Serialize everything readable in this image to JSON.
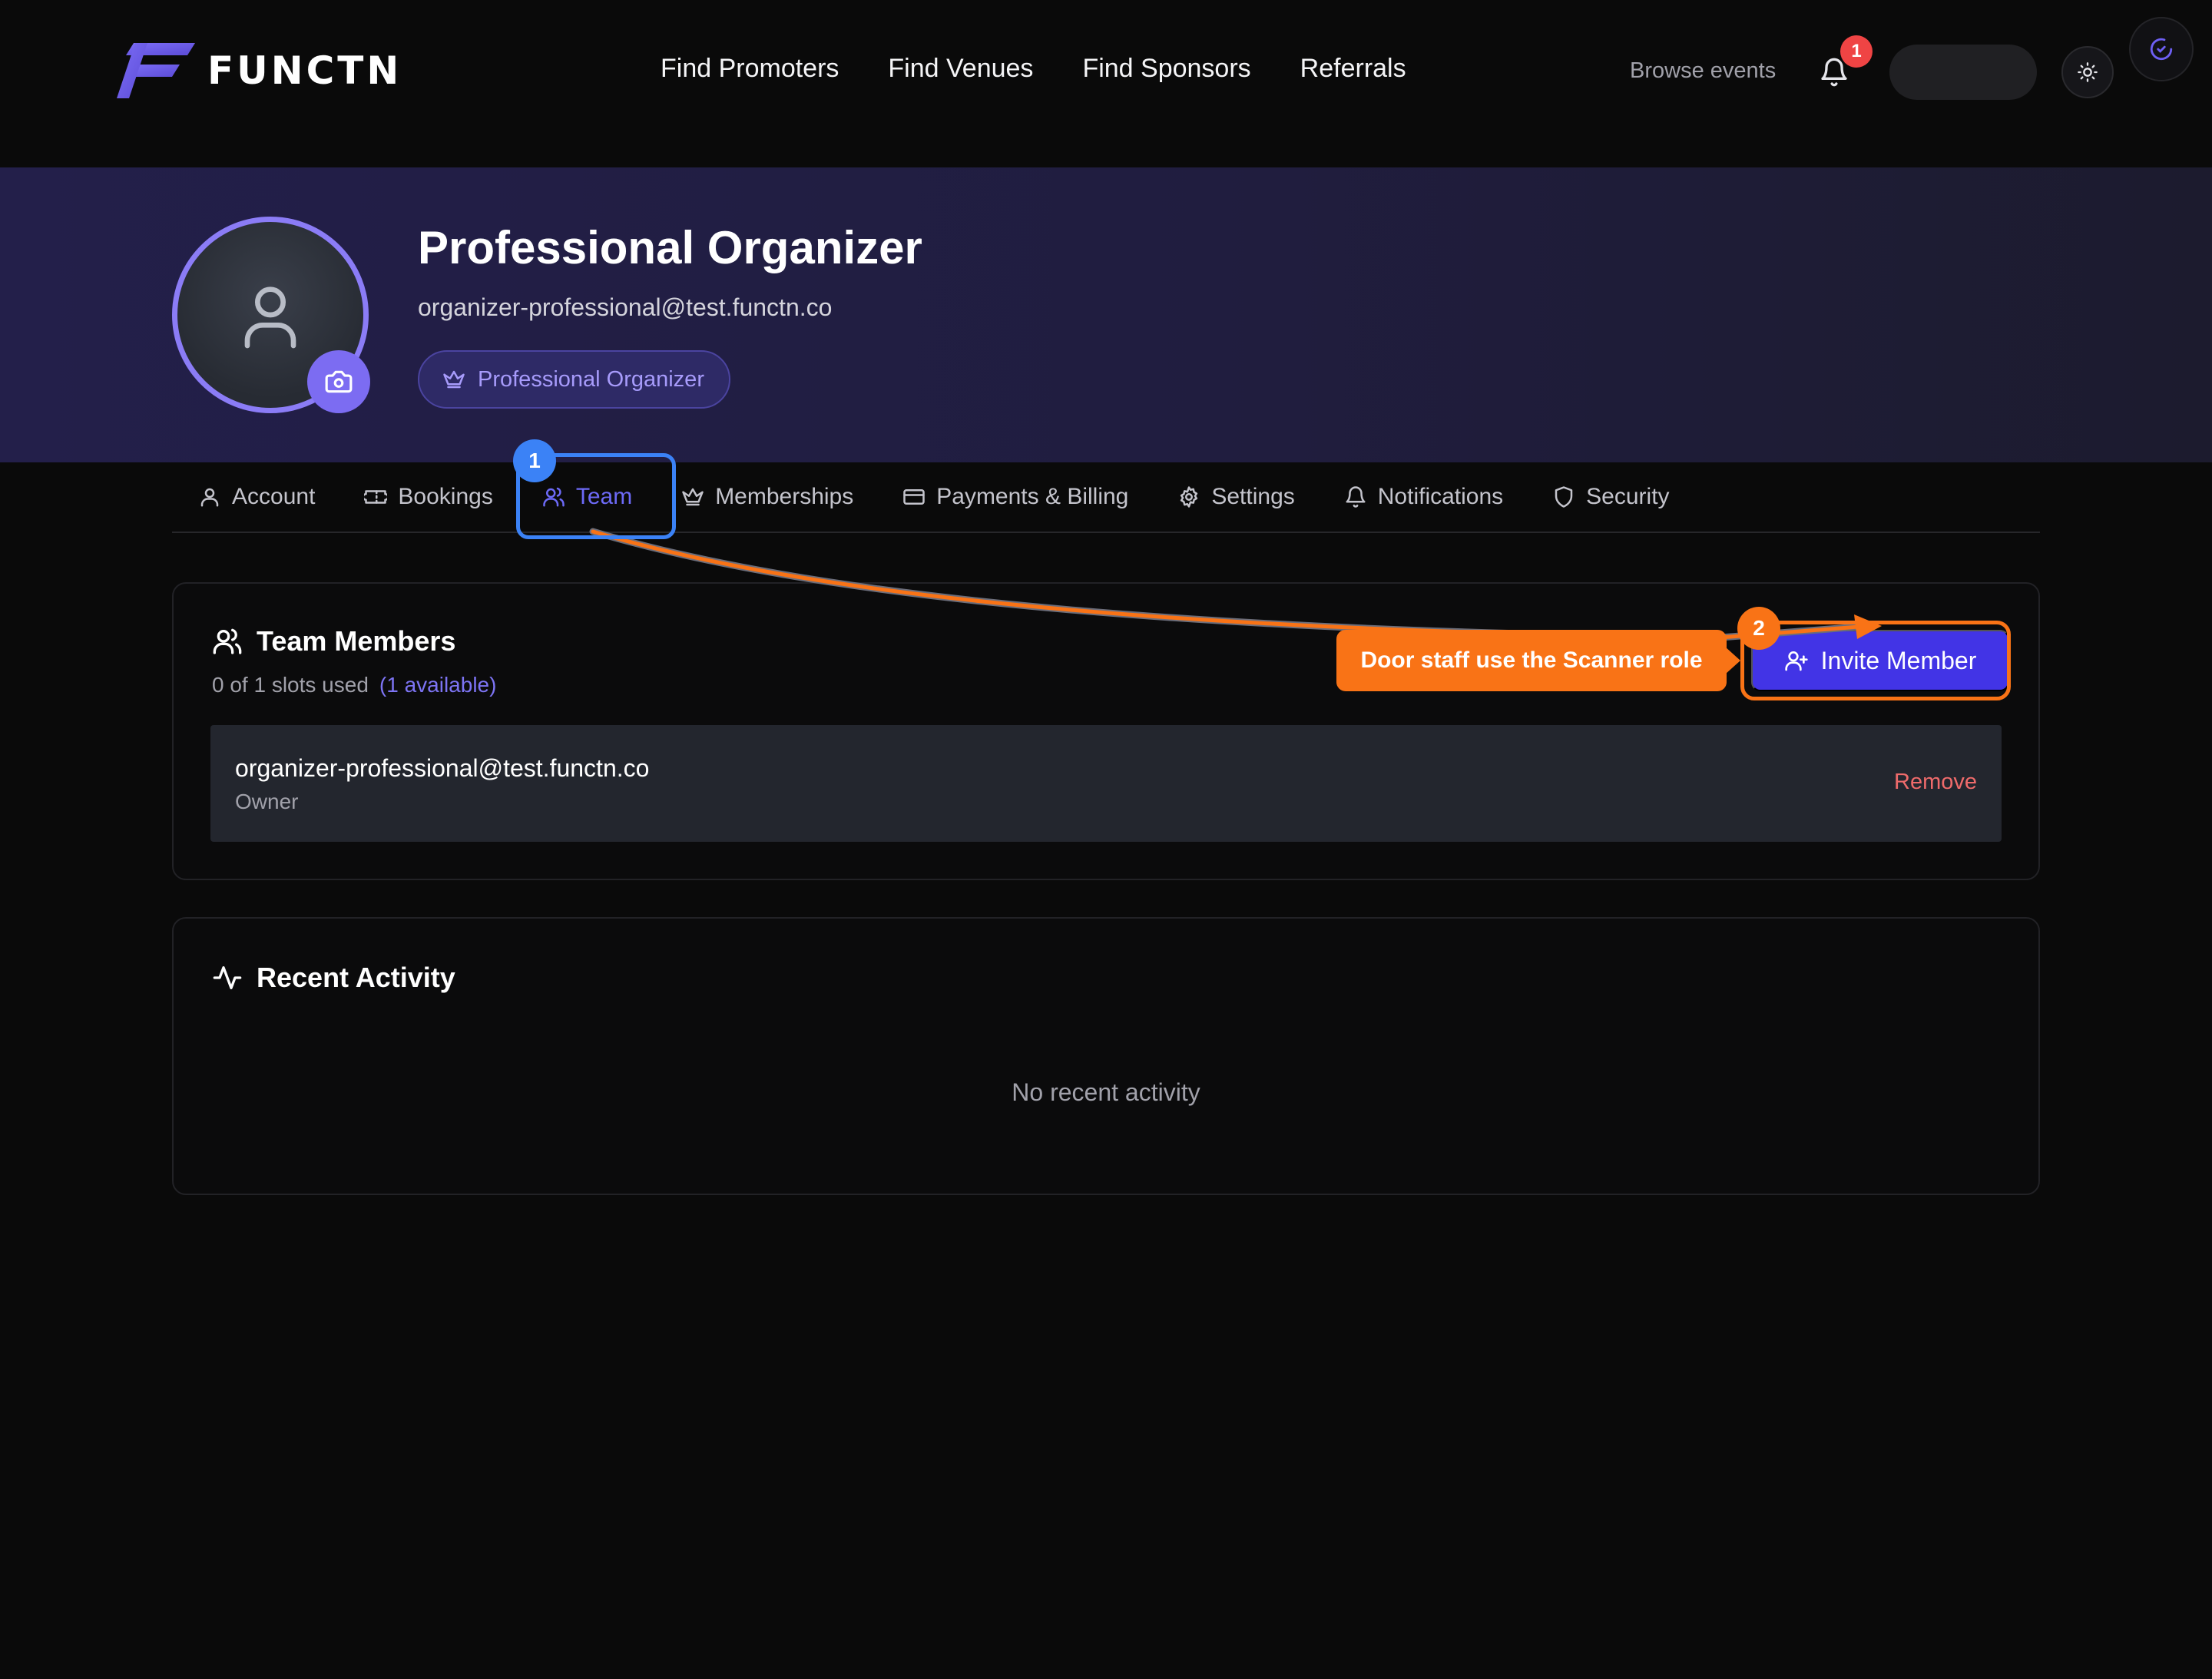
{
  "brand": {
    "name": "FUNCTN",
    "accent": "#6c5ce7"
  },
  "nav": {
    "links": [
      "Find Promoters",
      "Find Venues",
      "Find Sponsors",
      "Referrals"
    ],
    "browse_label": "Browse events",
    "notification_count": "1",
    "icons": {
      "bell": "bell-icon",
      "theme": "sun-icon",
      "corner": "spinner-icon"
    }
  },
  "profile": {
    "name": "Professional Organizer",
    "email": "organizer-professional@test.functn.co",
    "tier": "Professional Organizer",
    "icons": {
      "avatar": "user-icon",
      "upload": "camera-icon",
      "tier": "crown-icon"
    }
  },
  "tabs": [
    {
      "label": "Account",
      "icon": "user-icon",
      "active": false
    },
    {
      "label": "Bookings",
      "icon": "ticket-icon",
      "active": false
    },
    {
      "label": "Team",
      "icon": "users-icon",
      "active": true
    },
    {
      "label": "Memberships",
      "icon": "crown-icon",
      "active": false
    },
    {
      "label": "Payments & Billing",
      "icon": "credit-card-icon",
      "active": false
    },
    {
      "label": "Settings",
      "icon": "gear-icon",
      "active": false
    },
    {
      "label": "Notifications",
      "icon": "bell-icon",
      "active": false
    },
    {
      "label": "Security",
      "icon": "shield-icon",
      "active": false
    }
  ],
  "team": {
    "title": "Team Members",
    "slots_text": "0 of 1 slots used",
    "available_text": "(1 available)",
    "invite_label": "Invite Member",
    "members": [
      {
        "email": "organizer-professional@test.functn.co",
        "role": "Owner",
        "action": "Remove"
      }
    ]
  },
  "activity": {
    "title": "Recent Activity",
    "empty_text": "No recent activity"
  },
  "tutorial": {
    "step1": "1",
    "step2": "2",
    "callout": "Door staff use the Scanner role",
    "colors": {
      "step1": "#3b82f6",
      "step2": "#f97316"
    }
  }
}
